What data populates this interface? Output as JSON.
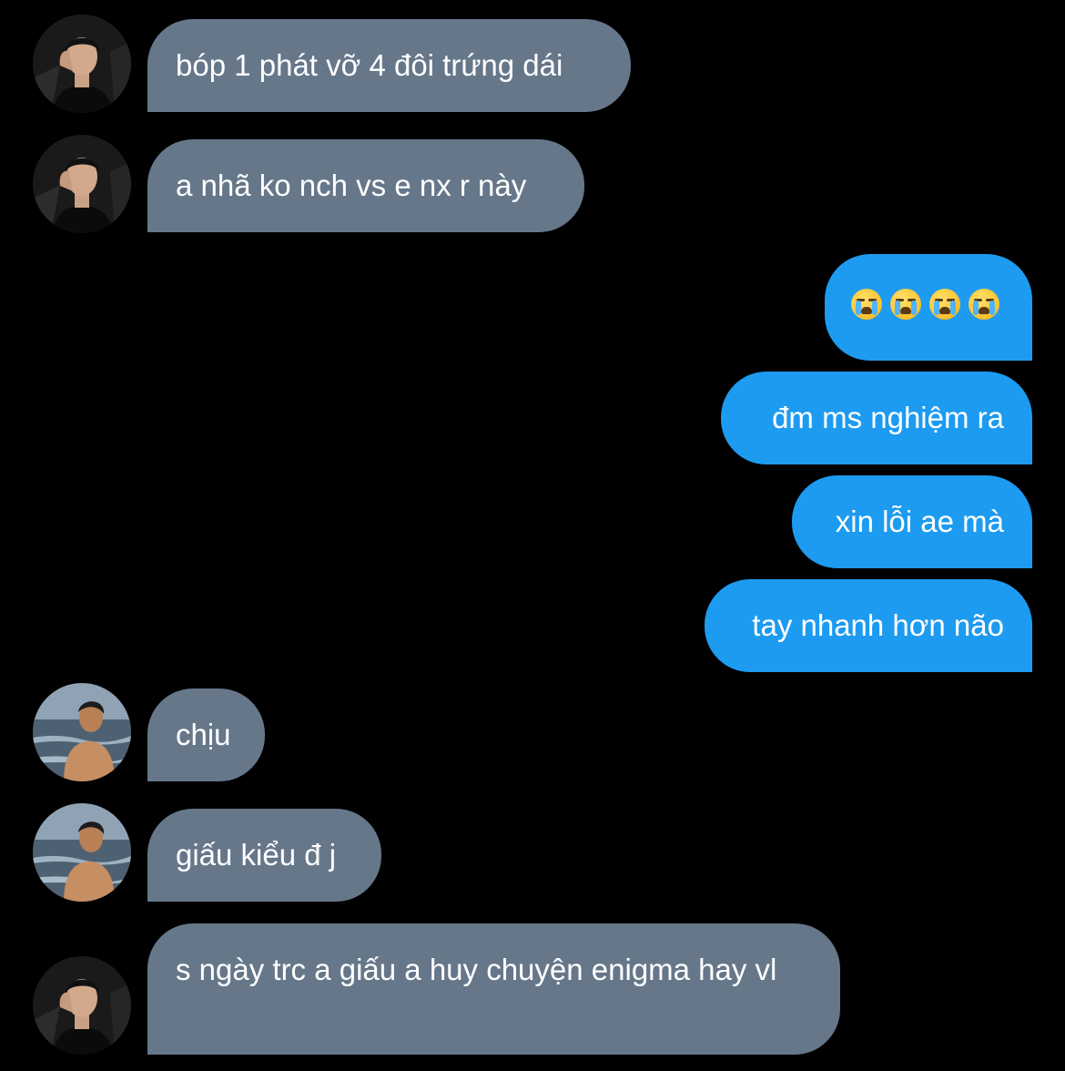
{
  "messages": [
    {
      "side": "in",
      "avatar": "dark-portrait-avatar",
      "text": "bóp 1 phát vỡ 4 đôi trứng dái"
    },
    {
      "side": "in",
      "avatar": "dark-portrait-avatar",
      "text": "a nhã ko nch vs e nx r này"
    },
    {
      "side": "out",
      "emoji": [
        "loudly-crying-face",
        "loudly-crying-face",
        "loudly-crying-face",
        "loudly-crying-face"
      ]
    },
    {
      "side": "out",
      "text": "đm ms nghiệm ra"
    },
    {
      "side": "out",
      "text": "xin lỗi ae mà"
    },
    {
      "side": "out",
      "text": "tay nhanh hơn não"
    },
    {
      "side": "in",
      "avatar": "beach-portrait-avatar",
      "text": "chịu"
    },
    {
      "side": "in",
      "avatar": "beach-portrait-avatar",
      "text": "giấu kiểu đ j"
    },
    {
      "side": "in",
      "avatar": "dark-portrait-avatar",
      "text": "s ngày trc a giấu a huy chuyện enigma hay vl"
    }
  ],
  "colors": {
    "background": "#000000",
    "incoming_bubble": "#66778a",
    "outgoing_bubble": "#1d9bf0",
    "text": "#ffffff"
  }
}
